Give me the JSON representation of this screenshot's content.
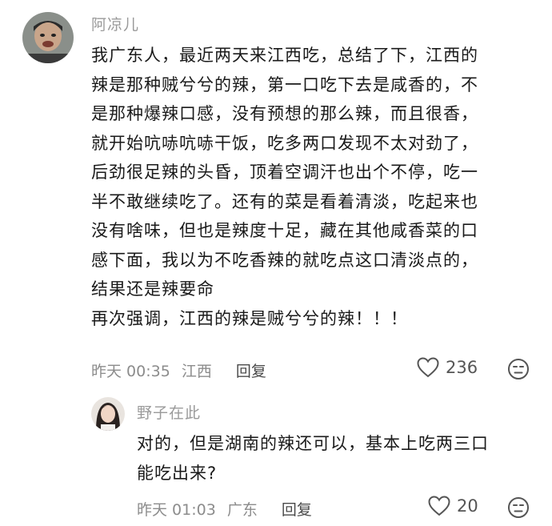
{
  "comment1": {
    "username": "阿凉儿",
    "lines": [
      "我广东人，最近两天来江西吃，总结了下，江西的",
      "辣是那种贼兮兮的辣，第一口吃下去是咸香的，不",
      "是那种爆辣口感，没有预想的那么辣，而且很香，",
      "就开始吭哧吭哧干饭，吃多两口发现不太对劲了，",
      "后劲很足辣的头昏，顶着空调汗也出个不停，吃一",
      "半不敢继续吃了。还有的菜是看着清淡，吃起来也",
      "没有啥味，但也是辣度十足，藏在其他咸香菜的口",
      "感下面，我以为不吃香辣的就吃点这口清淡点的，",
      "结果还是辣要命",
      "再次强调，江西的辣是贼兮兮的辣！！！"
    ],
    "time": "昨天 00:35",
    "location": "江西",
    "reply_label": "回复",
    "like_count": "236",
    "like_icon": "heart-outline-icon",
    "dislike_icon": "meh-face-icon"
  },
  "comment2": {
    "username": "野子在此",
    "lines": [
      "对的，但是湖南的辣还可以，基本上吃两三口",
      "能吃出来?"
    ],
    "time": "昨天 01:03",
    "location": "广东",
    "reply_label": "回复",
    "like_count": "20",
    "like_icon": "heart-outline-icon",
    "dislike_icon": "meh-face-icon"
  },
  "colors": {
    "username": "#9a9a9a",
    "text": "#1a1a1a",
    "meta": "#8c8c8c"
  }
}
